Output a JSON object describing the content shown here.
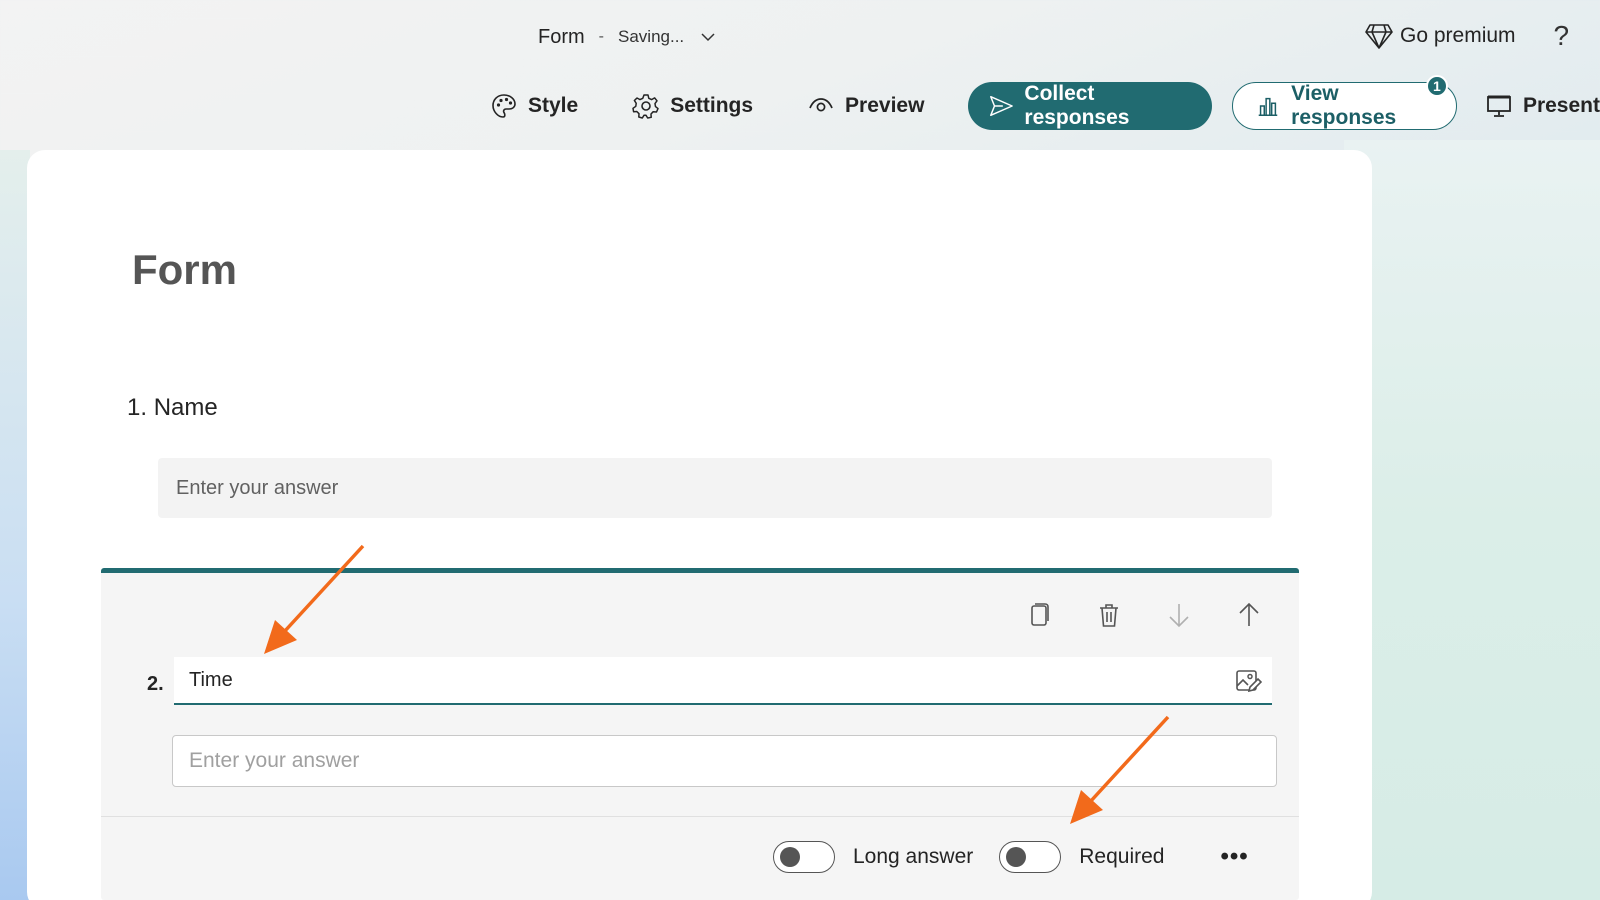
{
  "header": {
    "form_name": "Form",
    "separator": "-",
    "save_status": "Saving...",
    "premium_label": "Go premium",
    "help_label": "?"
  },
  "toolbar": {
    "style_label": "Style",
    "settings_label": "Settings",
    "preview_label": "Preview",
    "collect_label": "Collect responses",
    "view_label": "View responses",
    "view_badge": "1",
    "present_label": "Present"
  },
  "form": {
    "title": "Form",
    "questions": [
      {
        "number": "1.",
        "title": "Name",
        "placeholder": "Enter your answer"
      },
      {
        "number": "2.",
        "title": "Time",
        "placeholder": "Enter your answer"
      }
    ]
  },
  "question_options": {
    "long_answer_label": "Long answer",
    "long_answer_on": false,
    "required_label": "Required",
    "required_on": false,
    "more_label": "•••"
  },
  "colors": {
    "accent": "#216b71",
    "annotation": "#f26a1b"
  }
}
